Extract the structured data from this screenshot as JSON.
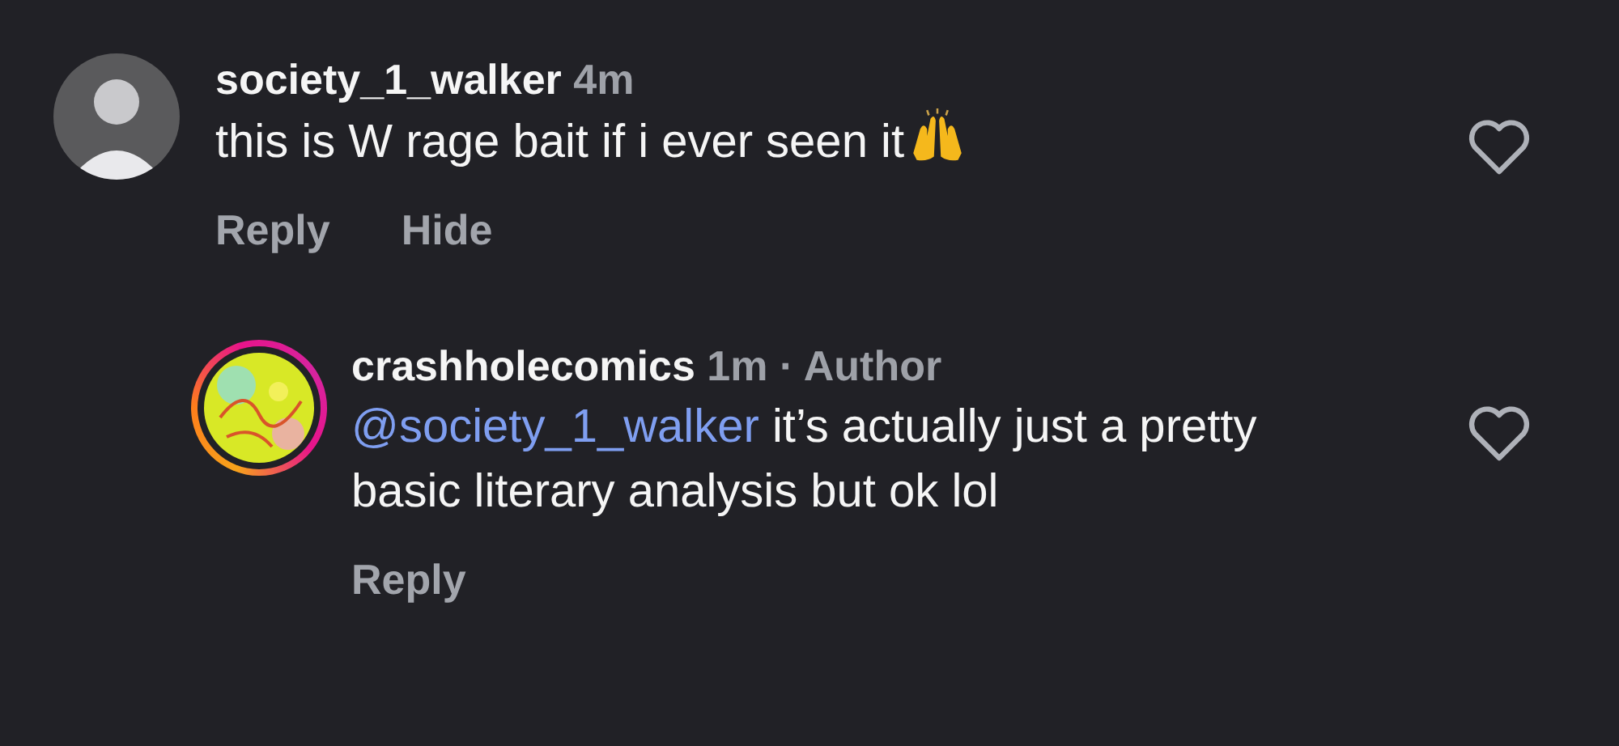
{
  "comments": [
    {
      "username": "society_1_walker",
      "time": "4m",
      "avatar": {
        "kind": "person"
      },
      "text": "this is W rage bait if i ever seen it",
      "emoji": {
        "kind": "raised-hands"
      },
      "liked": false,
      "actions": [
        "Reply",
        "Hide"
      ],
      "is_reply": false
    },
    {
      "username": "crashholecomics",
      "time": "1m",
      "author_label": "· Author",
      "avatar": {
        "kind": "picture"
      },
      "mention": "@society_1_walker",
      "text": "it’s actually just a pretty basic literary analysis but ok lol",
      "liked": false,
      "actions": [
        "Reply"
      ],
      "is_reply": true,
      "story_ring": true
    }
  ]
}
